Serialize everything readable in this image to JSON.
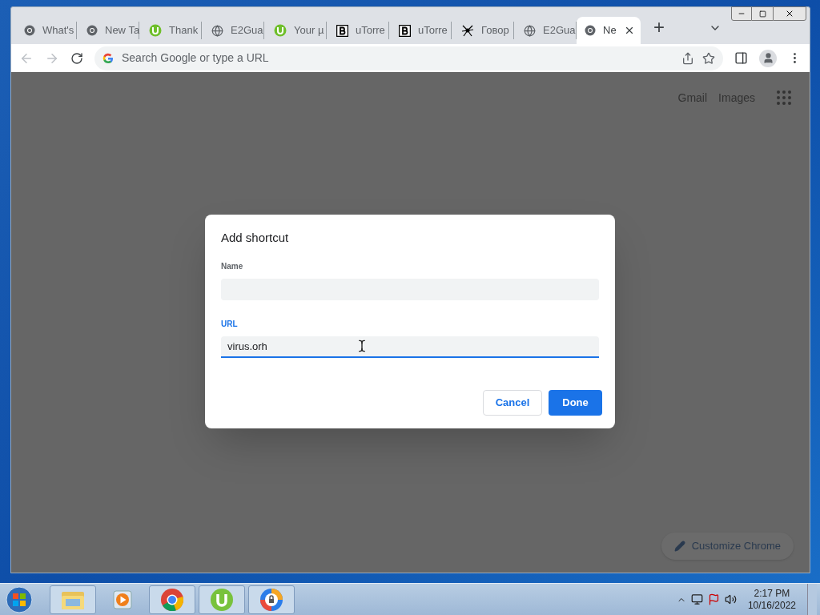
{
  "tabs": [
    {
      "label": "What's",
      "kind": "chrome",
      "selected": false
    },
    {
      "label": "New Ta",
      "kind": "chrome",
      "selected": false
    },
    {
      "label": "Thank",
      "kind": "utorrent",
      "selected": false
    },
    {
      "label": "E2Gua",
      "kind": "globe",
      "selected": false
    },
    {
      "label": "Your µ",
      "kind": "utorrent",
      "selected": false
    },
    {
      "label": "uTorre",
      "kind": "b",
      "selected": false
    },
    {
      "label": "uTorre",
      "kind": "b",
      "selected": false
    },
    {
      "label": "Говор",
      "kind": "spider",
      "selected": false
    },
    {
      "label": "E2Gua",
      "kind": "globe",
      "selected": false
    },
    {
      "label": "Ne",
      "kind": "chrome",
      "selected": true
    }
  ],
  "new_tab": "+",
  "omnibox": {
    "placeholder": "Search Google or type a URL"
  },
  "header_links": [
    "Gmail",
    "Images"
  ],
  "customize": "Customize Chrome",
  "dialog": {
    "title": "Add shortcut",
    "fields": [
      {
        "label": "Name",
        "focused": false
      },
      {
        "label": "URL",
        "value": "virus.orh",
        "focused": true
      }
    ],
    "cancel": "Cancel",
    "done": "Done"
  },
  "taskbar": {
    "apps": [
      {
        "kind": "explorer"
      },
      {
        "kind": "media"
      },
      {
        "kind": "chrome"
      },
      {
        "kind": "utorrent"
      },
      {
        "kind": "browser"
      }
    ],
    "time": "2:17 PM",
    "date": "10/16/2022"
  }
}
